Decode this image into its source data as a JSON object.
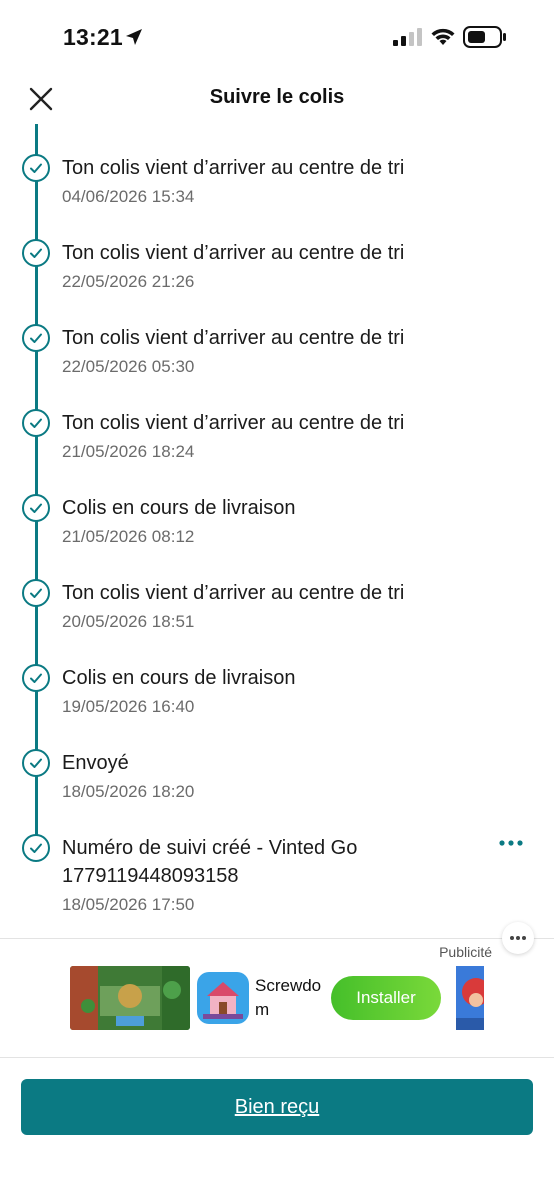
{
  "status_bar": {
    "time": "13:21"
  },
  "header": {
    "title": "Suivre le colis"
  },
  "events": [
    {
      "title": "Ton colis vient d’arriver au centre de tri",
      "date": "04/06/2026 15:34"
    },
    {
      "title": "Ton colis vient d’arriver au centre de tri",
      "date": "22/05/2026 21:26"
    },
    {
      "title": "Ton colis vient d’arriver au centre de tri",
      "date": "22/05/2026 05:30"
    },
    {
      "title": "Ton colis vient d’arriver au centre de tri",
      "date": "21/05/2026 18:24"
    },
    {
      "title": "Colis en cours de livraison",
      "date": "21/05/2026 08:12"
    },
    {
      "title": "Ton colis vient d’arriver au centre de tri",
      "date": "20/05/2026 18:51"
    },
    {
      "title": "Colis en cours de livraison",
      "date": "19/05/2026 16:40"
    },
    {
      "title": "Envoyé",
      "date": "18/05/2026 18:20"
    },
    {
      "title": "Numéro de suivi créé - Vinted Go",
      "subtitle": "1779119448093158",
      "date": "18/05/2026 17:50"
    }
  ],
  "ad": {
    "label": "Publicité",
    "app_name": "Screwdom",
    "install_label": "Installer"
  },
  "footer": {
    "confirm_label": "Bien reçu"
  },
  "colors": {
    "accent": "#0b7a83",
    "install_green": "#45bf2a"
  }
}
